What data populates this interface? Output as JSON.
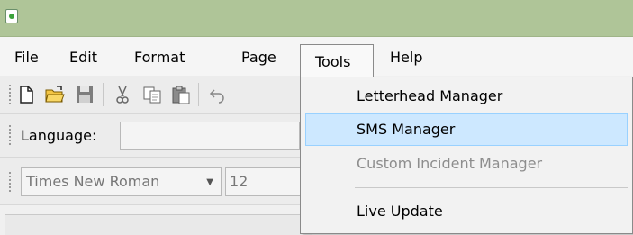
{
  "window": {
    "app_icon": "document-green-icon"
  },
  "menubar": {
    "items": [
      {
        "label": "File"
      },
      {
        "label": "Edit"
      },
      {
        "label": "Format"
      },
      {
        "label": "Page"
      },
      {
        "label": "Tools"
      },
      {
        "label": "Help"
      }
    ],
    "open_menu": "Tools"
  },
  "toolbar": {
    "icons": [
      "new-document-icon",
      "open-folder-icon",
      "save-disk-icon",
      "cut-scissors-icon",
      "copy-icon",
      "paste-icon",
      "undo-icon"
    ]
  },
  "language_bar": {
    "label": "Language:",
    "value": ""
  },
  "format_bar": {
    "font_name": "Times New Roman",
    "font_size": "12"
  },
  "tools_menu": {
    "items": [
      {
        "label": "Letterhead Manager",
        "state": "normal"
      },
      {
        "label": "SMS Manager",
        "state": "hover"
      },
      {
        "label": "Custom Incident Manager",
        "state": "disabled"
      },
      {
        "label": "Live Update",
        "state": "normal"
      }
    ]
  },
  "colors": {
    "title_bar": "#afc598",
    "hover_bg": "#cde8ff",
    "hover_border": "#99d1ff",
    "disabled_text": "#8d8d8d"
  }
}
